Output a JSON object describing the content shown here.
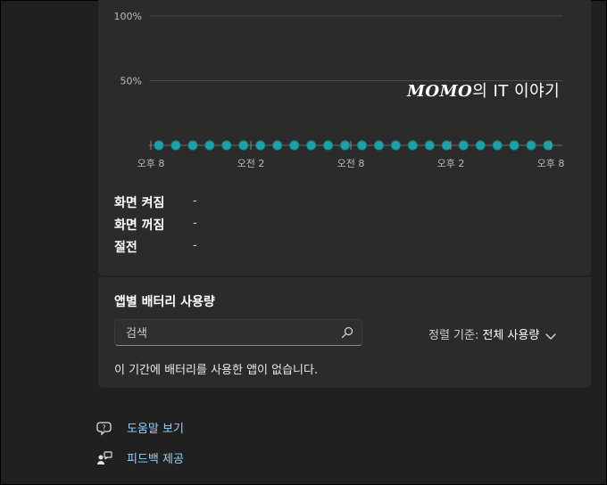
{
  "watermark": {
    "brand": "MOMO",
    "rest": "의 IT 이야기"
  },
  "chart_data": {
    "type": "scatter",
    "y_ticks": [
      "100%",
      "50%"
    ],
    "x_ticks": [
      "오후 8",
      "오전 2",
      "오전 8",
      "오후 2",
      "오후 8"
    ],
    "point_count": 24,
    "values": [
      0,
      0,
      0,
      0,
      0,
      0,
      0,
      0,
      0,
      0,
      0,
      0,
      0,
      0,
      0,
      0,
      0,
      0,
      0,
      0,
      0,
      0,
      0,
      0
    ],
    "ylim": [
      0,
      100
    ],
    "grid": true,
    "point_color": "#1fa0a8"
  },
  "stats": [
    {
      "label": "화면 켜짐",
      "value": "-"
    },
    {
      "label": "화면 꺼짐",
      "value": "-"
    },
    {
      "label": "절전",
      "value": "-"
    }
  ],
  "app_usage": {
    "title": "앱별 배터리 사용량",
    "search_placeholder": "검색",
    "sort_label": "정렬 기준:",
    "sort_value": "전체 사용량",
    "empty_message": "이 기간에 배터리를 사용한 앱이 없습니다."
  },
  "links": {
    "help": "도움말 보기",
    "feedback": "피드백 제공"
  },
  "colors": {
    "accent_link": "#8fd3ff",
    "card": "#2b2b2b",
    "background": "#202020"
  }
}
